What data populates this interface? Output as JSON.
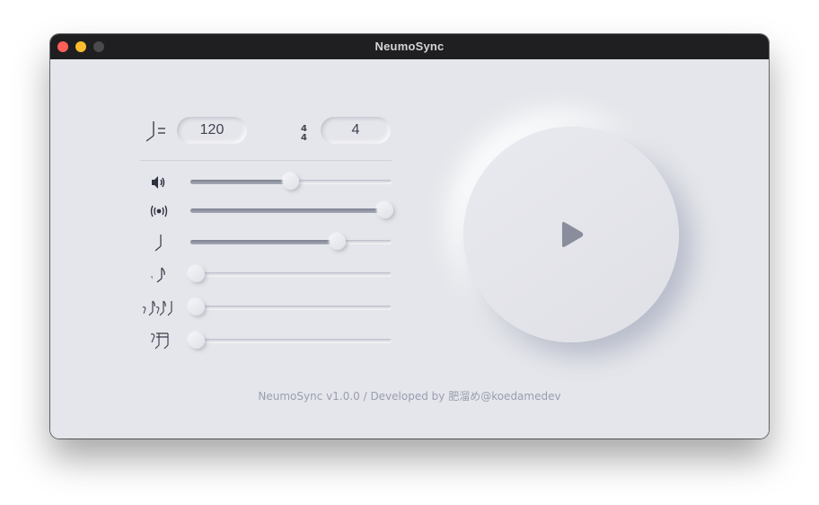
{
  "window": {
    "title": "NeumoSync",
    "traffic_lights": [
      "close",
      "minimize",
      "maximize"
    ]
  },
  "tempo": {
    "icon": "quarter-note-equals-icon",
    "value": "120"
  },
  "time_signature": {
    "icon": "time-signature-icon",
    "value": "4"
  },
  "sliders": [
    {
      "name": "volume",
      "icon": "speaker-volume-icon",
      "level": 0.5
    },
    {
      "name": "vibration",
      "icon": "vibration-waves-icon",
      "level": 0.97
    },
    {
      "name": "quarter-note",
      "icon": "quarter-note-icon",
      "level": 0.73
    },
    {
      "name": "eighth-note",
      "icon": "eighth-note-icon",
      "level": 0.0
    },
    {
      "name": "triplet",
      "icon": "triplet-notes-icon",
      "level": 0.0
    },
    {
      "name": "sixteenth-note",
      "icon": "sixteenth-notes-icon",
      "level": 0.0
    }
  ],
  "play": {
    "icon": "play-icon"
  },
  "footer": {
    "text": "NeumoSync v1.0.0 / Developed by 肥溜め@koedamedev"
  },
  "colors": {
    "background": "#e5e6eb",
    "accent": "#8a8d9c",
    "titlebar": "#1f1f21"
  }
}
